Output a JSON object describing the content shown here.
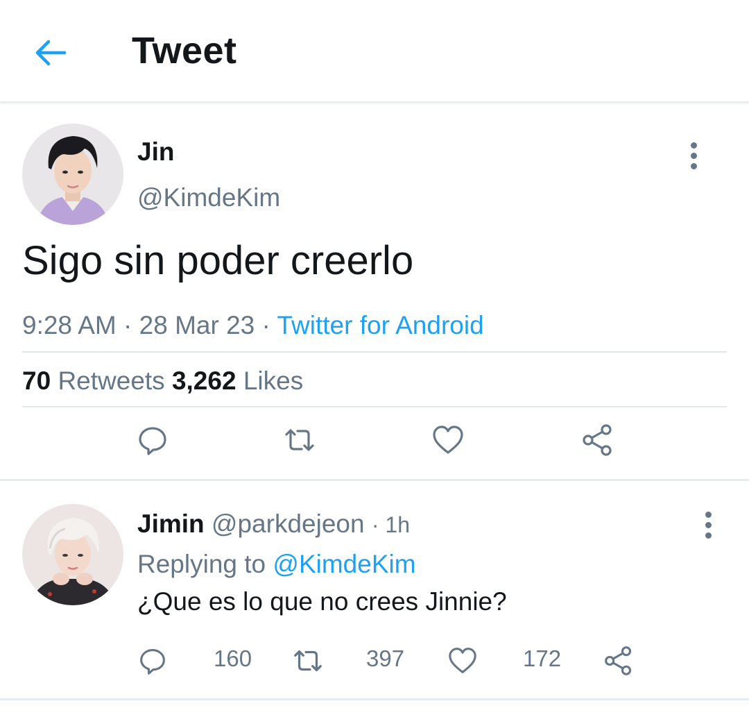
{
  "header": {
    "title": "Tweet"
  },
  "tweet": {
    "author_name": "Jin",
    "author_handle": "@KimdeKim",
    "text": "Sigo sin poder creerlo",
    "time": "9:28 AM",
    "date": "28 Mar 23",
    "separator": " · ",
    "source": "Twitter for Android",
    "retweets_count": "70",
    "retweets_label": "Retweets",
    "likes_count": "3,262",
    "likes_label": "Likes"
  },
  "reply": {
    "author_name": "Jimin",
    "author_handle": "@parkdejeon",
    "time": "· 1h",
    "replying_label": "Replying to",
    "replying_to": "@KimdeKim",
    "text": "¿Que es lo que no crees Jinnie?",
    "reply_count": "160",
    "retweet_count": "397",
    "like_count": "172"
  },
  "icons": {
    "back": "arrow-left-icon",
    "more": "more-vertical-icon",
    "reply": "comment-icon",
    "retweet": "retweet-icon",
    "like": "heart-icon",
    "share": "share-icon"
  },
  "colors": {
    "accent": "#1da1f2",
    "text_primary": "#14171a",
    "text_secondary": "#657786",
    "divider": "#e1e8ed"
  }
}
